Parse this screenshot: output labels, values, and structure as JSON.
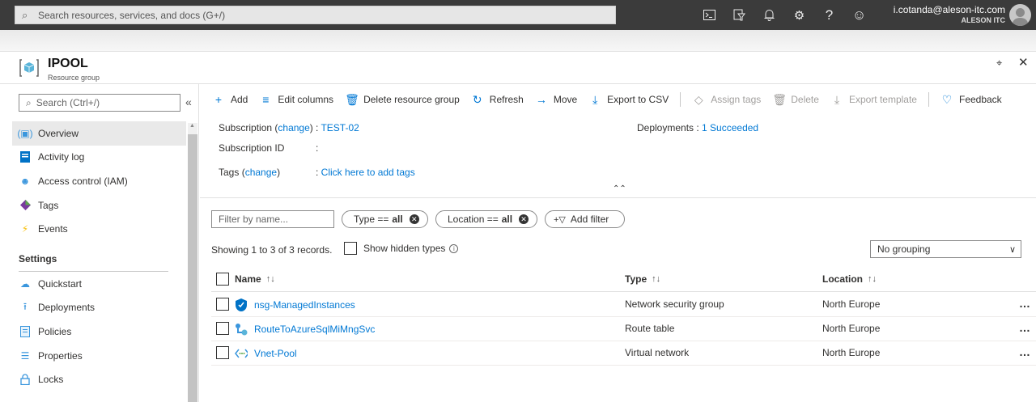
{
  "topbar": {
    "search_placeholder": "Search resources, services, and docs (G+/)",
    "user_email": "i.cotanda@aleson-itc.com",
    "user_org": "ALESON ITC",
    "icons": [
      "cloud-shell-icon",
      "directory-filter-icon",
      "notifications-icon",
      "settings-icon",
      "help-icon",
      "feedback-smiley-icon"
    ]
  },
  "blade": {
    "title": "IPOOL",
    "subtitle": "Resource group"
  },
  "sidebar": {
    "search_placeholder": "Search (Ctrl+/)",
    "items": [
      {
        "label": "Overview",
        "icon": "overview-icon",
        "active": true
      },
      {
        "label": "Activity log",
        "icon": "activity-log-icon"
      },
      {
        "label": "Access control (IAM)",
        "icon": "iam-icon"
      },
      {
        "label": "Tags",
        "icon": "tag-icon"
      },
      {
        "label": "Events",
        "icon": "events-icon"
      }
    ],
    "section": "Settings",
    "settings_items": [
      {
        "label": "Quickstart",
        "icon": "quickstart-icon"
      },
      {
        "label": "Deployments",
        "icon": "deployments-icon"
      },
      {
        "label": "Policies",
        "icon": "policies-icon"
      },
      {
        "label": "Properties",
        "icon": "properties-icon"
      },
      {
        "label": "Locks",
        "icon": "lock-icon"
      }
    ]
  },
  "toolbar": {
    "add": "Add",
    "edit_columns": "Edit columns",
    "delete_rg": "Delete resource group",
    "refresh": "Refresh",
    "move": "Move",
    "export_csv": "Export to CSV",
    "assign_tags": "Assign tags",
    "delete": "Delete",
    "export_template": "Export template",
    "feedback": "Feedback"
  },
  "essentials": {
    "subscription_label": "Subscription",
    "change": "change",
    "subscription_value": "TEST-02",
    "subscription_id_label": "Subscription ID",
    "tags_label": "Tags",
    "tags_value": "Click here to add tags",
    "deployments_label": "Deployments",
    "deployments_value": "1 Succeeded"
  },
  "filters": {
    "name_placeholder": "Filter by name...",
    "type_label": "Type ==",
    "type_value": "all",
    "location_label": "Location ==",
    "location_value": "all",
    "add_filter": "Add filter",
    "records": "Showing 1 to 3 of 3 records.",
    "show_hidden": "Show hidden types",
    "grouping": "No grouping"
  },
  "table": {
    "headers": {
      "name": "Name",
      "type": "Type",
      "location": "Location"
    },
    "rows": [
      {
        "name": "nsg-ManagedInstances",
        "type": "Network security group",
        "location": "North Europe",
        "icon": "nsg-shield-icon"
      },
      {
        "name": "RouteToAzureSqlMiMngSvc",
        "type": "Route table",
        "location": "North Europe",
        "icon": "route-table-icon"
      },
      {
        "name": "Vnet-Pool",
        "type": "Virtual network",
        "location": "North Europe",
        "icon": "vnet-icon"
      }
    ]
  },
  "colors": {
    "accent": "#0078d4",
    "topbar": "#3b3b3b"
  }
}
